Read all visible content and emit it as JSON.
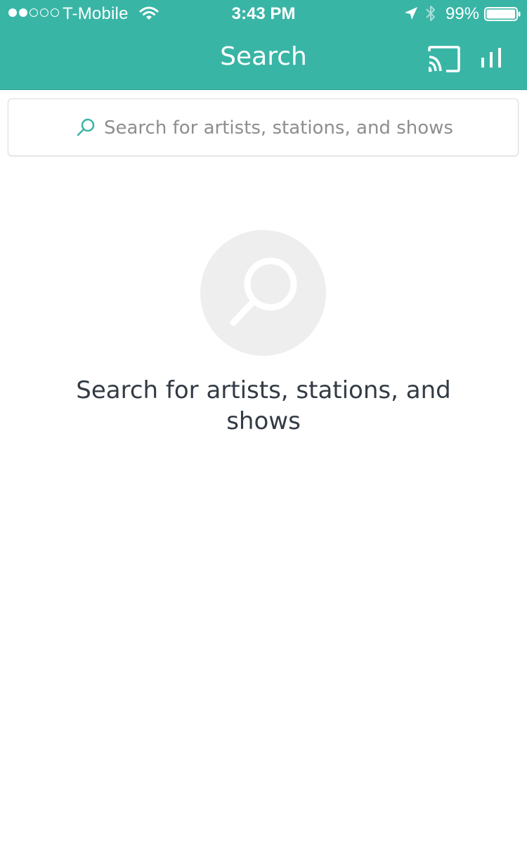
{
  "status_bar": {
    "carrier": "T-Mobile",
    "signal_strength": 2,
    "signal_max": 5,
    "time": "3:43 PM",
    "battery_percent": "99%",
    "battery_level": 0.99,
    "icons": [
      "signal-dots-icon",
      "wifi-icon",
      "location-arrow-icon",
      "bluetooth-icon",
      "battery-icon"
    ]
  },
  "nav": {
    "title": "Search",
    "actions": [
      "cast-icon",
      "equalizer-icon"
    ]
  },
  "search": {
    "placeholder": "Search for artists, stations, and shows",
    "value": "",
    "icon": "search-icon"
  },
  "empty_state": {
    "icon": "search-icon",
    "message": "Search for artists, stations, and shows"
  },
  "colors": {
    "accent": "#39b5a6",
    "empty_circle": "#eeeeee",
    "text_dark": "#333b45",
    "placeholder": "#8e8e8e"
  }
}
